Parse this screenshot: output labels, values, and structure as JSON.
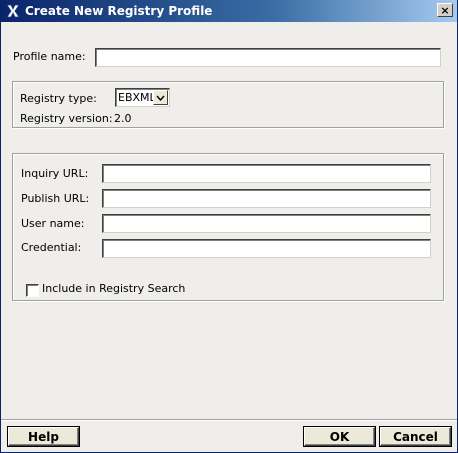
{
  "window": {
    "title": "Create New Registry Profile",
    "close_glyph": "×",
    "icons": {
      "app": "app-logo-icon",
      "close": "close-icon"
    }
  },
  "profile": {
    "name_label": "Profile name:",
    "name_value": ""
  },
  "registry": {
    "type_label": "Registry type:",
    "type_value": "EBXML",
    "version_label": "Registry version:",
    "version_value": "2.0"
  },
  "connection": {
    "inquiry_url_label": "Inquiry URL:",
    "inquiry_url_value": "",
    "publish_url_label": "Publish URL:",
    "publish_url_value": "",
    "user_name_label": "User name:",
    "user_name_value": "",
    "credential_label": "Credential:",
    "credential_value": "",
    "include_search_label": "Include in Registry Search",
    "include_search_checked": false
  },
  "buttons": {
    "help_label": "Help",
    "ok_label": "OK",
    "cancel_label": "Cancel"
  }
}
